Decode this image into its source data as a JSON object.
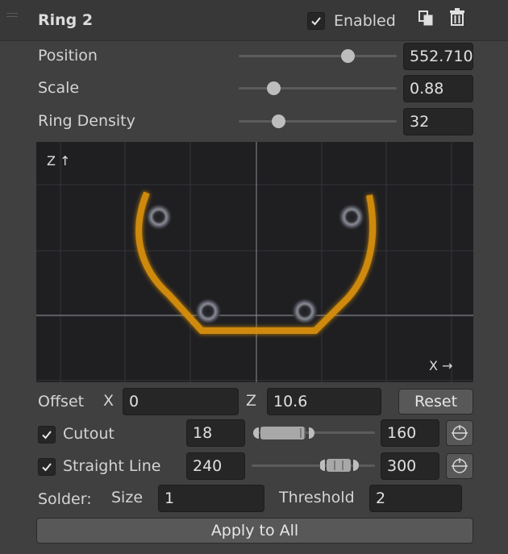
{
  "header": {
    "title": "Ring 2",
    "enabled_label": "Enabled",
    "enabled_checked": true,
    "copy_icon": "copy-icon",
    "delete_icon": "trash-icon"
  },
  "params": {
    "position": {
      "label": "Position",
      "value": "552.710",
      "slider_fraction": 0.69
    },
    "scale": {
      "label": "Scale",
      "value": "0.88",
      "slider_fraction": 0.22
    },
    "density": {
      "label": "Ring Density",
      "value": "32",
      "slider_fraction": 0.25
    }
  },
  "viewport": {
    "z_axis_label": "Z ↑",
    "x_axis_label": "X →",
    "curve_color": "#d9900f",
    "background_color": "#1f1f22"
  },
  "offset": {
    "label": "Offset",
    "x_label": "X",
    "x_value": "0",
    "z_label": "Z",
    "z_value": "10.6",
    "reset_label": "Reset"
  },
  "cutout": {
    "label": "Cutout",
    "checked": true,
    "min_value": "18",
    "max_value": "160",
    "range_fraction": [
      0.05,
      0.5
    ],
    "picker_icon": "target-icon"
  },
  "straight_line": {
    "label": "Straight Line",
    "checked": true,
    "min_value": "240",
    "max_value": "300",
    "range_fraction": [
      0.6,
      0.72
    ],
    "picker_icon": "target-icon"
  },
  "solder": {
    "label": "Solder:",
    "size_label": "Size",
    "size_value": "1",
    "threshold_label": "Threshold",
    "threshold_value": "2"
  },
  "apply_label": "Apply to All"
}
